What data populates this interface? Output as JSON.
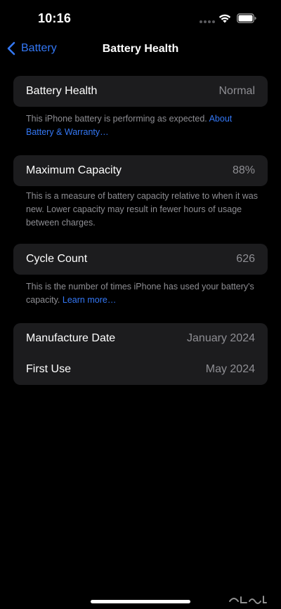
{
  "status_bar": {
    "time": "10:16"
  },
  "nav": {
    "back_label": "Battery",
    "title": "Battery Health"
  },
  "battery_health": {
    "label": "Battery Health",
    "value": "Normal",
    "footer_text": "This iPhone battery is performing as expected.",
    "footer_link": "About Battery & Warranty…"
  },
  "maximum_capacity": {
    "label": "Maximum Capacity",
    "value": "88%",
    "footer_text": "This is a measure of battery capacity relative to when it was new. Lower capacity may result in fewer hours of usage between charges."
  },
  "cycle_count": {
    "label": "Cycle Count",
    "value": "626",
    "footer_text": "This is the number of times iPhone has used your battery's capacity.",
    "footer_link": "Learn more…"
  },
  "dates": {
    "manufacture_label": "Manufacture Date",
    "manufacture_value": "January 2024",
    "first_use_label": "First Use",
    "first_use_value": "May 2024"
  },
  "colors": {
    "accent": "#3478f6",
    "cell_background": "#1c1c1e",
    "secondary_text": "#8e8e93"
  },
  "icons": [
    "chevron-left-icon",
    "wifi-icon",
    "battery-icon",
    "cellular-signal-icon"
  ]
}
